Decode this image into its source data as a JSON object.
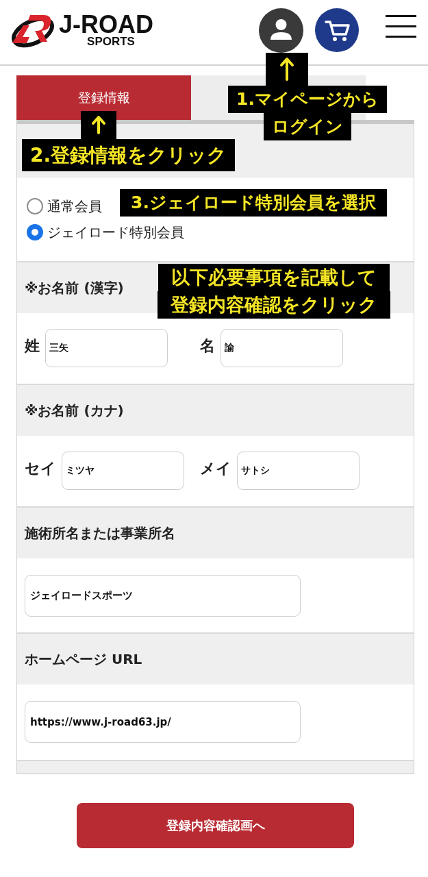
{
  "header": {
    "logo": {
      "wordmark": "J-ROAD",
      "tagline": "SPORTS"
    }
  },
  "tabs": [
    {
      "label": "登録情報",
      "selected": true
    },
    {
      "selected": false
    }
  ],
  "membership_options": [
    {
      "label": "通常会員",
      "selected": false
    },
    {
      "label": "ジェイロード特別会員",
      "selected": true
    }
  ],
  "sections": [
    {
      "kind": "pair",
      "title": "※お名前 (漢字)",
      "fields": [
        {
          "label": "姓",
          "value": "三矢"
        },
        {
          "label": "名",
          "value": "諭"
        }
      ]
    },
    {
      "kind": "pair",
      "title": "※お名前 (カナ)",
      "fields": [
        {
          "label": "セイ",
          "value": "ミツヤ"
        },
        {
          "label": "メイ",
          "value": "サトシ"
        }
      ]
    },
    {
      "kind": "single",
      "title": "施術所名または事業所名",
      "fields": [
        {
          "value": "ジェイロードスポーツ"
        }
      ]
    },
    {
      "kind": "single",
      "title": "ホームページ URL",
      "fields": [
        {
          "value": "https://www.j-road63.jp/"
        }
      ]
    }
  ],
  "submit_button": {
    "label": "登録内容確認画へ"
  },
  "annotations": [
    {
      "lines": [
        "1.マイページから",
        "ログイン"
      ],
      "arrow": true
    },
    {
      "lines": [
        "2.登録情報をクリック"
      ],
      "arrow": true
    },
    {
      "lines": [
        "3.ジェイロード特別会員を選択"
      ],
      "arrow": false
    },
    {
      "lines": [
        "以下必要事項を記載して",
        "登録内容確認をクリック"
      ],
      "arrow": false
    }
  ]
}
